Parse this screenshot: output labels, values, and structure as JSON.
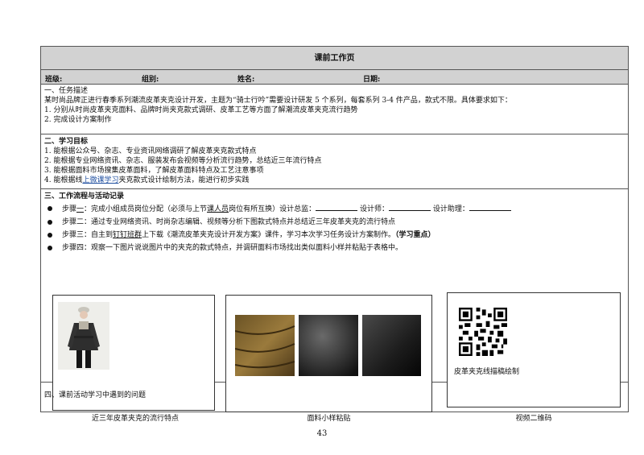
{
  "header": {
    "title": "课前工作页",
    "class_label": "班级:",
    "group_label": "组别:",
    "name_label": "姓名:",
    "date_label": "日期:"
  },
  "section1": {
    "heading": "一、任务描述",
    "desc": "某时尚品牌正进行春季系列潮流皮革夹克设计开发，主题为“骑士行吟”需要设计研发 5 个系列，每套系列 3-4 件产品，款式不限。具体要求如下：",
    "items": [
      "1.  分别从时尚皮革夹克面料、品牌时尚夹克款式调研、皮革工艺等方面了解潮流皮革夹克流行趋势",
      "2.  完成设计方案制作"
    ]
  },
  "section2": {
    "heading": "二、学习目标",
    "items": [
      "1.  能根据公众号、杂志、专业资讯网络调研了解皮革夹克款式特点",
      "2.  能根据专业网络资讯、杂志、服装发布会视频等分析流行趋势，总结近三年流行特点",
      "3.  能根据面料市场搜集皮革面料，了解皮革面料特点及工艺注意事项"
    ],
    "item4_pre": "4.  能根据线",
    "item4_ul": "上微课学习",
    "item4_post": "夹克款式设计绘制方法，能进行初步实践"
  },
  "section3": {
    "heading": "三、工作流程与活动记录",
    "step1_a": "步骤",
    "step1_b": "一",
    "step1_c": "：完成小组成员岗位分配（必须与上节",
    "step1_d": "课人员",
    "step1_e": "岗位有所互换）设计总监：",
    "step1_f": " 设计师：",
    "step1_g": " 设计助理：",
    "step2": "步骤二：通过专业网络资讯、时尚杂志编辑、视频等分析下图款式特点并总结近三年皮革夹克的流行特点",
    "step3_a": "步骤三：自主到",
    "step3_b": "钉钉班群",
    "step3_c": "上下载《潮流皮革夹克设计开发方案》课件，学习本次学习任务设计方案制作。",
    "step3_d": "（学习重点）",
    "step4": "步骤四：观察一下图片说说图片中的夹克的款式特点，并调研面料市场找出类似面料小样并粘贴于表格中。",
    "box3_text": "皮革夹克线描稿绘制",
    "caption1": "近三年皮革夹克的流行特点",
    "caption2": "面料小样粘贴",
    "caption3": "视频二维码"
  },
  "section4": {
    "heading": "四、课前活动学习中遇到的问题"
  },
  "page_number": "43"
}
